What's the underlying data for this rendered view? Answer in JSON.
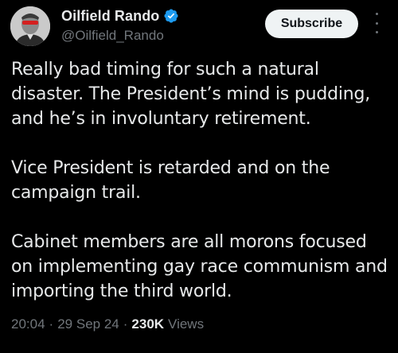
{
  "author": {
    "display_name": "Oilfield Rando",
    "handle": "@Oilfield_Rando",
    "verified": true,
    "avatar_icon": "person-avatar-icon"
  },
  "actions": {
    "subscribe_label": "Subscribe",
    "more_icon": "more-vertical-icon"
  },
  "tweet": {
    "paragraphs": [
      "Really bad timing for such a natural disaster. The President’s mind is pudding, and he’s in involuntary retirement.",
      "Vice President is retarded and on the campaign trail.",
      "Cabinet members are all morons focused on implementing gay race communism and importing the third world."
    ]
  },
  "meta": {
    "time": "20:04",
    "date": "29 Sep 24",
    "separator": "·",
    "views_count": "230K",
    "views_label": "Views"
  },
  "colors": {
    "background": "#000000",
    "text_primary": "#e7e9ea",
    "text_secondary": "#71767b",
    "verified_blue": "#1d9bf0",
    "subscribe_bg": "#eff3f4"
  }
}
